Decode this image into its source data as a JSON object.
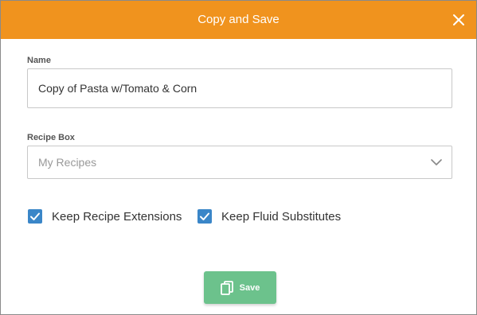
{
  "dialog": {
    "title": "Copy and Save",
    "close_icon": "close-icon",
    "accent_color": "#f0931e"
  },
  "form": {
    "name_label": "Name",
    "name_value": "Copy of Pasta w/Tomato & Corn",
    "recipe_box_label": "Recipe Box",
    "recipe_box_value": "My Recipes",
    "recipe_box_icon": "chevron-down-icon"
  },
  "options": {
    "keep_extensions_label": "Keep Recipe Extensions",
    "keep_extensions_checked": true,
    "keep_fluid_label": "Keep Fluid Substitutes",
    "keep_fluid_checked": true,
    "checkbox_color": "#3a86c8"
  },
  "footer": {
    "save_label": "Save",
    "save_icon": "copy-icon",
    "save_color": "#6cc28c"
  }
}
